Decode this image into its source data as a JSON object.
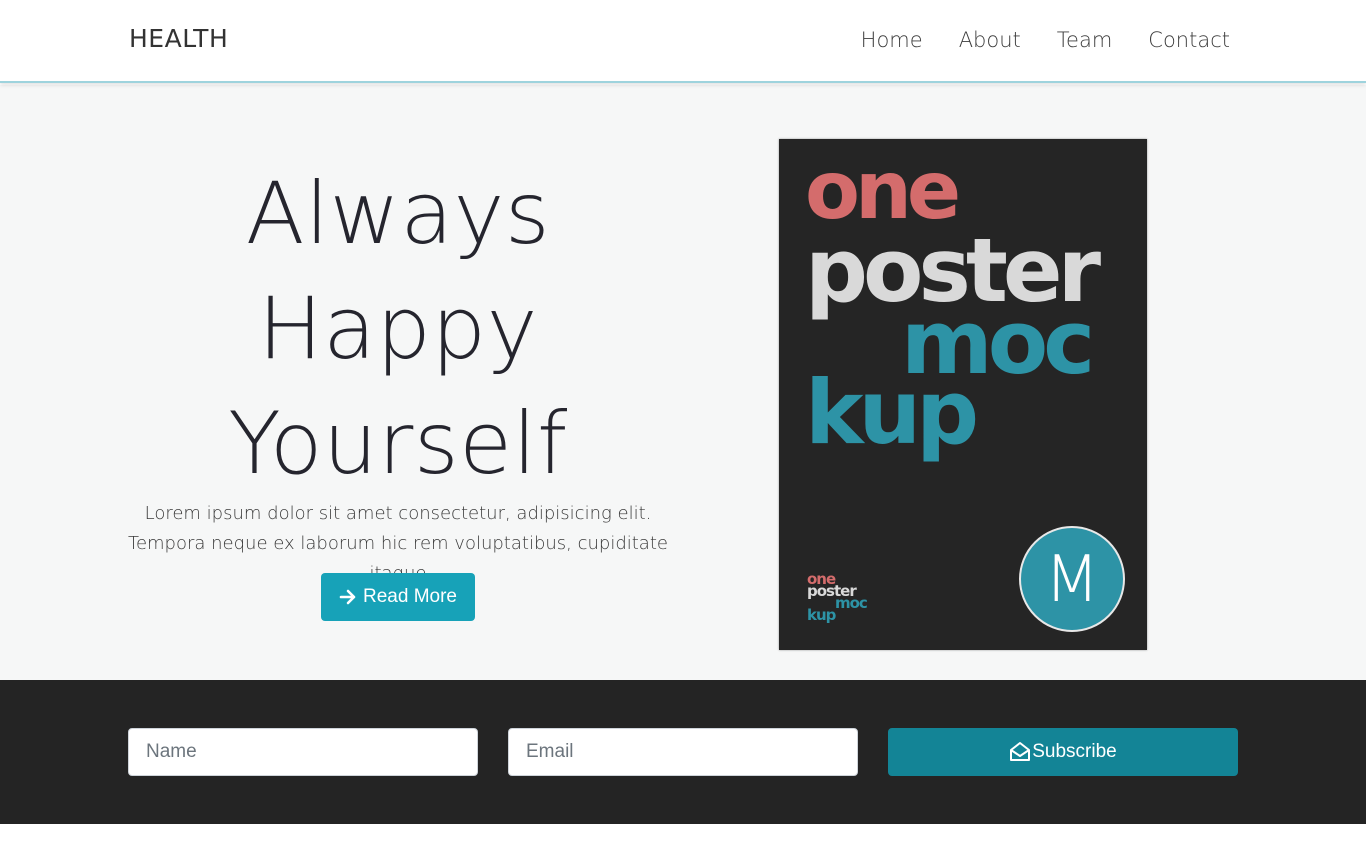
{
  "navbar": {
    "brand": "HEALTH",
    "links": [
      "Home",
      "About",
      "Team",
      "Contact"
    ]
  },
  "hero": {
    "title_line1": "Always",
    "title_line2": "Happy",
    "title_line3": "Yourself",
    "text": "Lorem ipsum dolor sit amet consectetur, adipisicing elit. Tempora neque ex laborum hic rem voluptatibus, cupiditate itaque",
    "button_label": "Read More",
    "button_icon": "arrow-right-icon"
  },
  "poster": {
    "words": [
      "one",
      "poster",
      "moc",
      "kup"
    ],
    "badge_letter": "M",
    "colors": {
      "background": "#252525",
      "one": "#d46c6c",
      "poster": "#d9d9d9",
      "accent": "#2d93a6"
    }
  },
  "subscribe": {
    "name_placeholder": "Name",
    "email_placeholder": "Email",
    "button_label": "Subscribe",
    "button_icon": "envelope-open-icon"
  },
  "colors": {
    "primary": "#17a2b8",
    "primary_dark": "#138496",
    "footer_bg": "#242424",
    "hero_bg": "#f6f7f7"
  }
}
